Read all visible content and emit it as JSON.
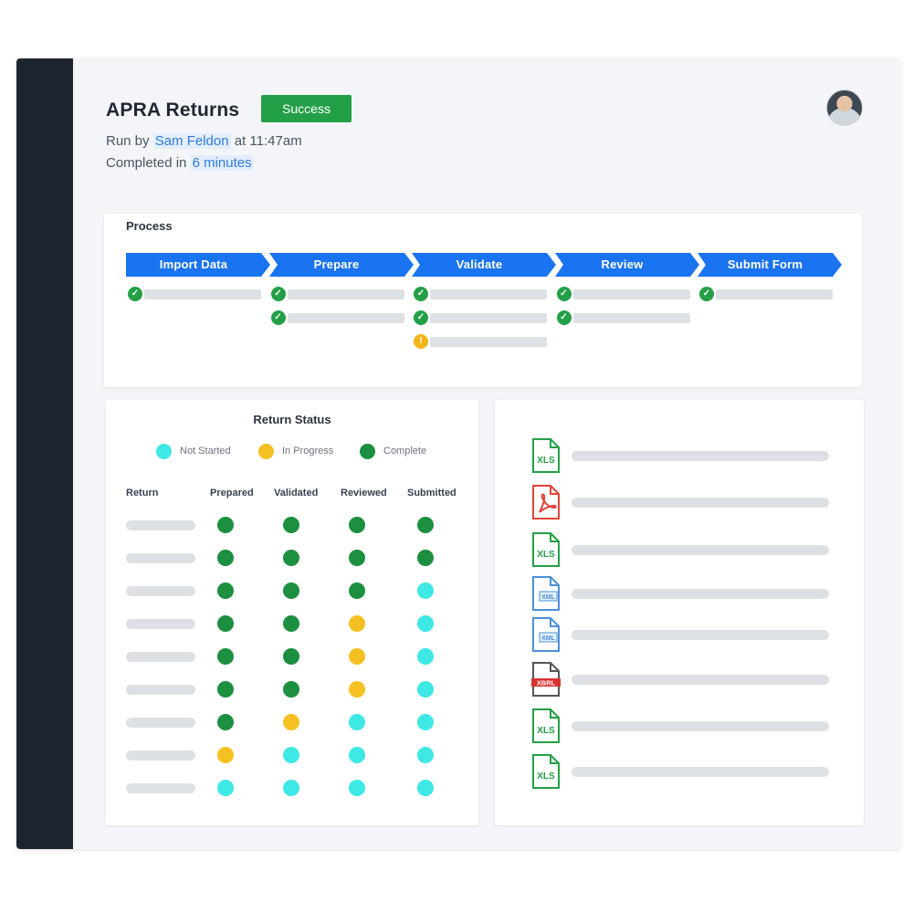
{
  "header": {
    "title": "APRA Returns",
    "status": "Success",
    "run_by_prefix": "Run by",
    "run_by_user": "Sam Feldon",
    "run_at": "at 11:47am",
    "completed_prefix": "Completed in",
    "duration": "6 minutes"
  },
  "process": {
    "title": "Process",
    "stages": [
      {
        "label": "Import Data",
        "tasks": [
          "complete"
        ]
      },
      {
        "label": "Prepare",
        "tasks": [
          "complete",
          "complete"
        ]
      },
      {
        "label": "Validate",
        "tasks": [
          "complete",
          "complete",
          "warning"
        ]
      },
      {
        "label": "Review",
        "tasks": [
          "complete",
          "complete"
        ]
      },
      {
        "label": "Submit Form",
        "tasks": [
          "complete"
        ]
      }
    ],
    "warning_symbol": "!"
  },
  "return_status": {
    "title": "Return Status",
    "legend": [
      {
        "label": "Not Started",
        "color": "#3ee8e4"
      },
      {
        "label": "In Progress",
        "color": "#f5c122"
      },
      {
        "label": "Complete",
        "color": "#1c8f40"
      }
    ],
    "columns": [
      "Return",
      "Prepared",
      "Validated",
      "Reviewed",
      "Submitted"
    ],
    "rows": [
      [
        "complete",
        "complete",
        "complete",
        "complete"
      ],
      [
        "complete",
        "complete",
        "complete",
        "complete"
      ],
      [
        "complete",
        "complete",
        "complete",
        "not_started"
      ],
      [
        "complete",
        "complete",
        "in_progress",
        "not_started"
      ],
      [
        "complete",
        "complete",
        "in_progress",
        "not_started"
      ],
      [
        "complete",
        "complete",
        "in_progress",
        "not_started"
      ],
      [
        "complete",
        "in_progress",
        "not_started",
        "not_started"
      ],
      [
        "in_progress",
        "not_started",
        "not_started",
        "not_started"
      ],
      [
        "not_started",
        "not_started",
        "not_started",
        "not_started"
      ]
    ]
  },
  "files": [
    {
      "type": "xls",
      "label": "XLS",
      "color": "#23a047"
    },
    {
      "type": "pdf",
      "label": "",
      "color": "#e0443a"
    },
    {
      "type": "xls",
      "label": "XLS",
      "color": "#23a047"
    },
    {
      "type": "xml",
      "label": "XML",
      "color": "#4a90d9"
    },
    {
      "type": "xml",
      "label": "XML",
      "color": "#4a90d9"
    },
    {
      "type": "xbrl",
      "label": "XBRL",
      "color": "#d8322e"
    },
    {
      "type": "xls",
      "label": "XLS",
      "color": "#23a047"
    },
    {
      "type": "xls",
      "label": "XLS",
      "color": "#23a047"
    }
  ],
  "colors": {
    "stage": "#1a73f0",
    "complete": "#1c8f40",
    "in_progress": "#f5c122",
    "not_started": "#3ee8e4",
    "success": "#23a047"
  }
}
